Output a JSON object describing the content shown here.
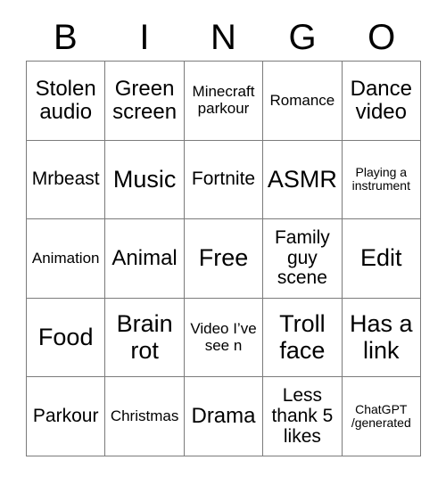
{
  "header": {
    "letters": [
      "B",
      "I",
      "N",
      "G",
      "O"
    ]
  },
  "grid": {
    "columns": 5,
    "rows": 5,
    "cells": [
      {
        "text": "Stolen audio",
        "size": "fs-lg"
      },
      {
        "text": "Green screen",
        "size": "fs-lg"
      },
      {
        "text": "Minecraft parkour",
        "size": "fs-sm"
      },
      {
        "text": "Romance",
        "size": "fs-sm"
      },
      {
        "text": "Dance video",
        "size": "fs-lg"
      },
      {
        "text": "Mrbeast",
        "size": "fs-md"
      },
      {
        "text": "Music",
        "size": "fs-xl"
      },
      {
        "text": "Fortnite",
        "size": "fs-md"
      },
      {
        "text": "ASMR",
        "size": "fs-xl"
      },
      {
        "text": "Playing a instrument",
        "size": "fs-xs"
      },
      {
        "text": "Animation",
        "size": "fs-sm"
      },
      {
        "text": "Animal",
        "size": "fs-lg"
      },
      {
        "text": "Free",
        "size": "fs-xl"
      },
      {
        "text": "Family guy scene",
        "size": "fs-md"
      },
      {
        "text": "Edit",
        "size": "fs-xl"
      },
      {
        "text": "Food",
        "size": "fs-xl"
      },
      {
        "text": "Brain rot",
        "size": "fs-xl"
      },
      {
        "text": "Video I’ve see n",
        "size": "fs-sm"
      },
      {
        "text": "Troll face",
        "size": "fs-xl"
      },
      {
        "text": "Has a link",
        "size": "fs-xl"
      },
      {
        "text": "Parkour",
        "size": "fs-md"
      },
      {
        "text": "Christmas",
        "size": "fs-sm"
      },
      {
        "text": "Drama",
        "size": "fs-lg"
      },
      {
        "text": "Less thank 5 likes",
        "size": "fs-md"
      },
      {
        "text": "ChatGPT /generated",
        "size": "fs-xs"
      }
    ]
  },
  "colors": {
    "border": "#7b7b7b",
    "text": "#000000",
    "background": "#ffffff"
  }
}
